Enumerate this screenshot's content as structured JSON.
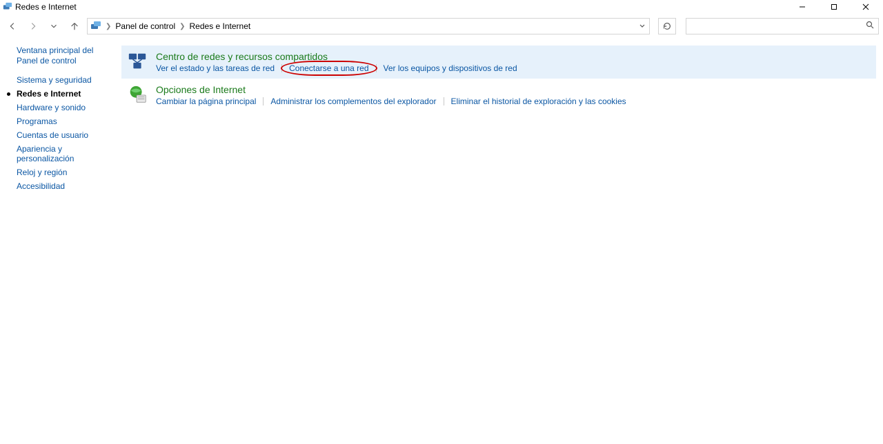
{
  "window": {
    "title": "Redes e Internet"
  },
  "breadcrumb": {
    "part1": "Panel de control",
    "part2": "Redes e Internet"
  },
  "search": {
    "placeholder": ""
  },
  "sidebar": {
    "home": "Ventana principal del Panel de control",
    "items": [
      {
        "label": "Sistema y seguridad",
        "active": false
      },
      {
        "label": "Redes e Internet",
        "active": true
      },
      {
        "label": "Hardware y sonido",
        "active": false
      },
      {
        "label": "Programas",
        "active": false
      },
      {
        "label": "Cuentas de usuario",
        "active": false
      },
      {
        "label": "Apariencia y personalización",
        "active": false
      },
      {
        "label": "Reloj y región",
        "active": false
      },
      {
        "label": "Accesibilidad",
        "active": false
      }
    ]
  },
  "cat1": {
    "title": "Centro de redes y recursos compartidos",
    "link1": "Ver el estado y las tareas de red",
    "link2": "Conectarse a una red",
    "link3": "Ver los equipos y dispositivos de red"
  },
  "cat2": {
    "title": "Opciones de Internet",
    "link1": "Cambiar la página principal",
    "link2": "Administrar los complementos del explorador",
    "link3": "Eliminar el historial de exploración y las cookies"
  },
  "colors": {
    "link_green": "#1a7a1a",
    "link_blue": "#0a56a3",
    "highlight_bg": "#e6f1fb",
    "annotation_red": "#c00"
  }
}
